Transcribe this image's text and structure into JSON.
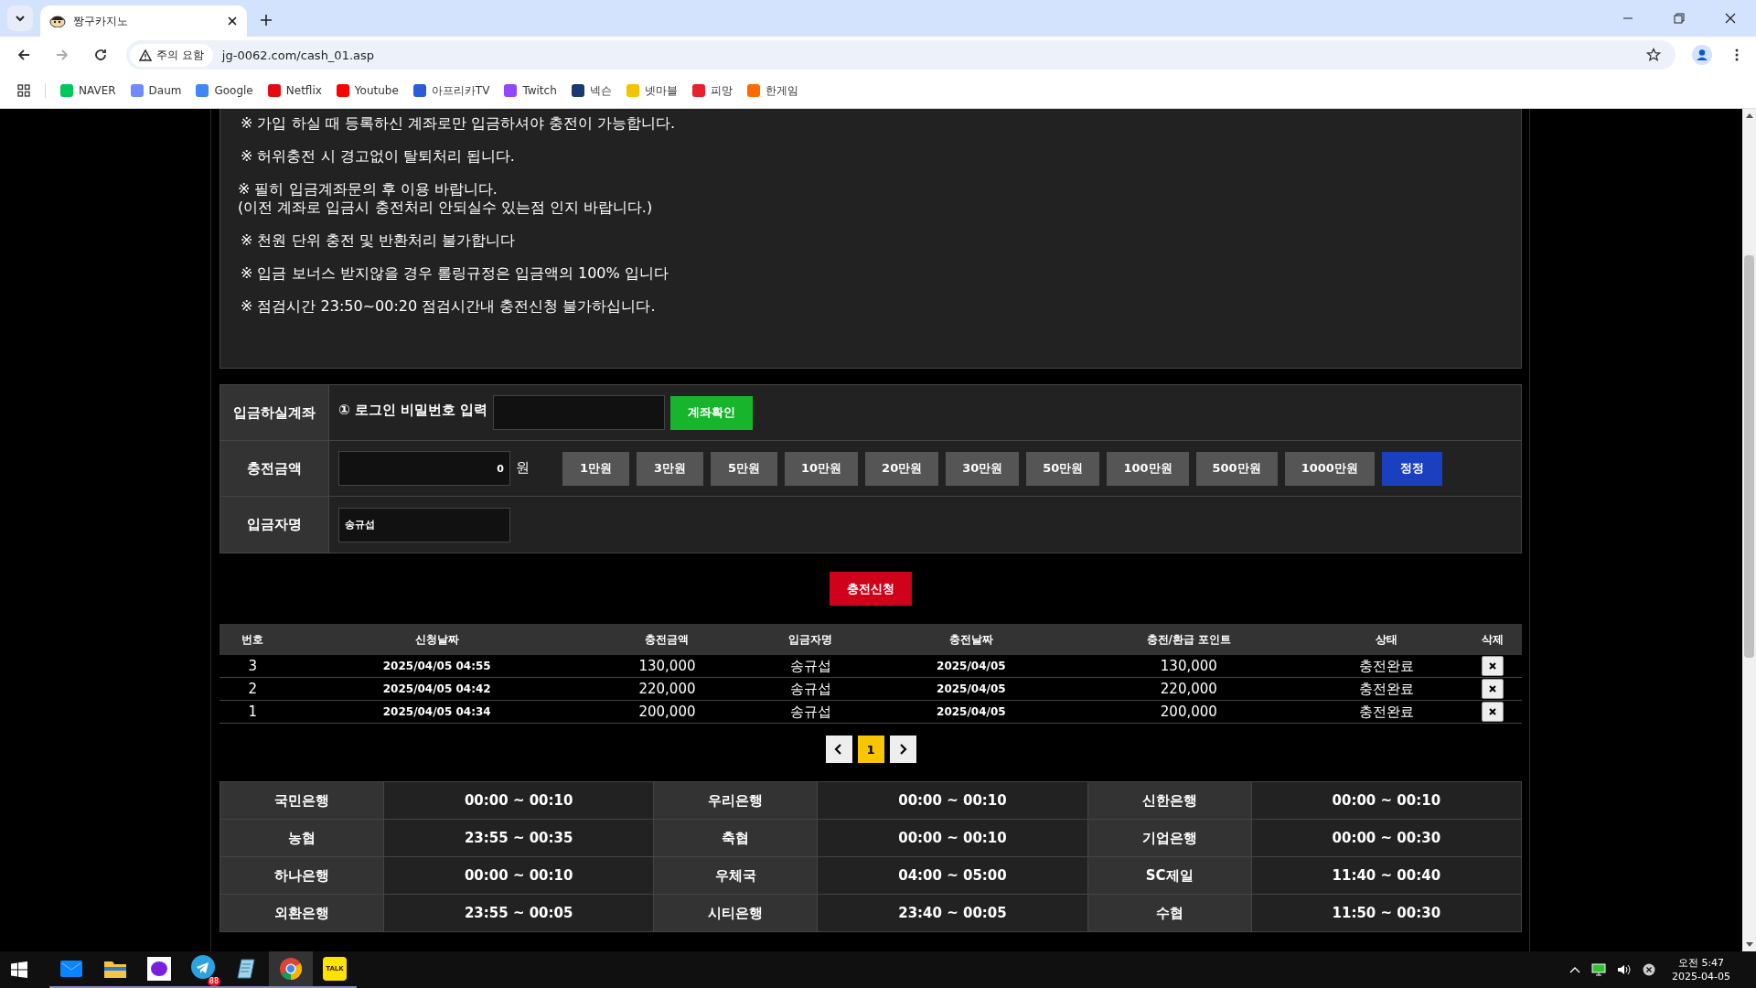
{
  "browser": {
    "tab_title": "짱구카지노",
    "security_label": "주의 요함",
    "url": "jg-0062.com/cash_01.asp",
    "bookmarks": [
      {
        "label": "NAVER",
        "color": "#03c75a"
      },
      {
        "label": "Daum",
        "color": "#6e8bff"
      },
      {
        "label": "Google",
        "color": "#4285f4"
      },
      {
        "label": "Netflix",
        "color": "#e50914"
      },
      {
        "label": "Youtube",
        "color": "#ff0000"
      },
      {
        "label": "아프리카TV",
        "color": "#2c5bd8"
      },
      {
        "label": "Twitch",
        "color": "#9146ff"
      },
      {
        "label": "넥슨",
        "color": "#1a3a6b"
      },
      {
        "label": "넷마블",
        "color": "#f5c400"
      },
      {
        "label": "피망",
        "color": "#e8212e"
      },
      {
        "label": "한게임",
        "color": "#ff6a00"
      }
    ]
  },
  "notices": [
    [
      "※ 가입 하실 때 등록하신 계좌로만 입금하셔야 충전이 가능합니다."
    ],
    [
      "※ 허위충전 시 경고없이 탈퇴처리 됩니다."
    ],
    [
      "※ 필히 입금계좌문의 후 이용 바랍니다.",
      "(이전 계좌로 입금시 충전처리 안되실수 있는점 인지 바랍니다.)"
    ],
    [
      "※ 천원 단위 충전 및 반환처리 불가합니다"
    ],
    [
      "※ 입금 보너스 받지않을 경우 롤링규정은 입금액의 100% 입니다"
    ],
    [
      "※ 점검시간 23:50~00:20 점검시간내 충전신청 불가하십니다."
    ]
  ],
  "form": {
    "account": {
      "label": "입금하실계좌",
      "prompt": "① 로그인 비밀번호 입력",
      "button": "계좌확인"
    },
    "amount": {
      "label": "충전금액",
      "value": "0",
      "unit": "원",
      "quick_buttons": [
        {
          "label": "1만원",
          "kind": "add"
        },
        {
          "label": "3만원",
          "kind": "add"
        },
        {
          "label": "5만원",
          "kind": "add"
        },
        {
          "label": "10만원",
          "kind": "add"
        },
        {
          "label": "20만원",
          "kind": "add"
        },
        {
          "label": "30만원",
          "kind": "add"
        },
        {
          "label": "50만원",
          "kind": "add"
        },
        {
          "label": "100만원",
          "kind": "add"
        },
        {
          "label": "500만원",
          "kind": "add"
        },
        {
          "label": "1000만원",
          "kind": "add"
        },
        {
          "label": "정정",
          "kind": "reset"
        }
      ]
    },
    "depositor": {
      "label": "입금자명",
      "value": "송규섭"
    },
    "submit": "충전신청"
  },
  "history": {
    "columns": [
      "번호",
      "신청날짜",
      "충전금액",
      "입금자명",
      "충전날짜",
      "충전/환급 포인트",
      "상태",
      "삭제"
    ],
    "rows": [
      [
        "3",
        "2025/04/05 04:55",
        "130,000",
        "송규섭",
        "2025/04/05",
        "130,000",
        "충전완료"
      ],
      [
        "2",
        "2025/04/05 04:42",
        "220,000",
        "송규섭",
        "2025/04/05",
        "220,000",
        "충전완료"
      ],
      [
        "1",
        "2025/04/05 04:34",
        "200,000",
        "송규섭",
        "2025/04/05",
        "200,000",
        "충전완료"
      ]
    ]
  },
  "pagination": {
    "pages": [
      {
        "label": "1",
        "selected": true
      }
    ]
  },
  "bank_hours": [
    [
      {
        "name": "국민은행",
        "time": "00:00 ~ 00:10"
      },
      {
        "name": "우리은행",
        "time": "00:00 ~ 00:10"
      },
      {
        "name": "신한은행",
        "time": "00:00 ~ 00:10"
      }
    ],
    [
      {
        "name": "농협",
        "time": "23:55 ~ 00:35"
      },
      {
        "name": "축협",
        "time": "00:00 ~ 00:10"
      },
      {
        "name": "기업은행",
        "time": "00:00 ~ 00:30"
      }
    ],
    [
      {
        "name": "하나은행",
        "time": "00:00 ~ 00:10"
      },
      {
        "name": "우체국",
        "time": "04:00 ~ 05:00"
      },
      {
        "name": "SC제일",
        "time": "11:40 ~ 00:40"
      }
    ],
    [
      {
        "name": "외환은행",
        "time": "23:55 ~ 00:05"
      },
      {
        "name": "시티은행",
        "time": "23:40 ~ 00:05"
      },
      {
        "name": "수협",
        "time": "11:50 ~ 00:30"
      }
    ]
  ],
  "taskbar": {
    "apps": [
      {
        "kind": "mail",
        "selected": false
      },
      {
        "kind": "folder",
        "selected": false
      },
      {
        "kind": "purple",
        "selected": false
      },
      {
        "kind": "telegram",
        "badge": "88",
        "selected": false
      },
      {
        "kind": "notes",
        "selected": false
      },
      {
        "kind": "chrome",
        "selected": true
      },
      {
        "kind": "kakao",
        "label": "TALK",
        "selected": false
      }
    ],
    "clock": {
      "time": "오전 5:47",
      "date": "2025-04-05"
    }
  }
}
